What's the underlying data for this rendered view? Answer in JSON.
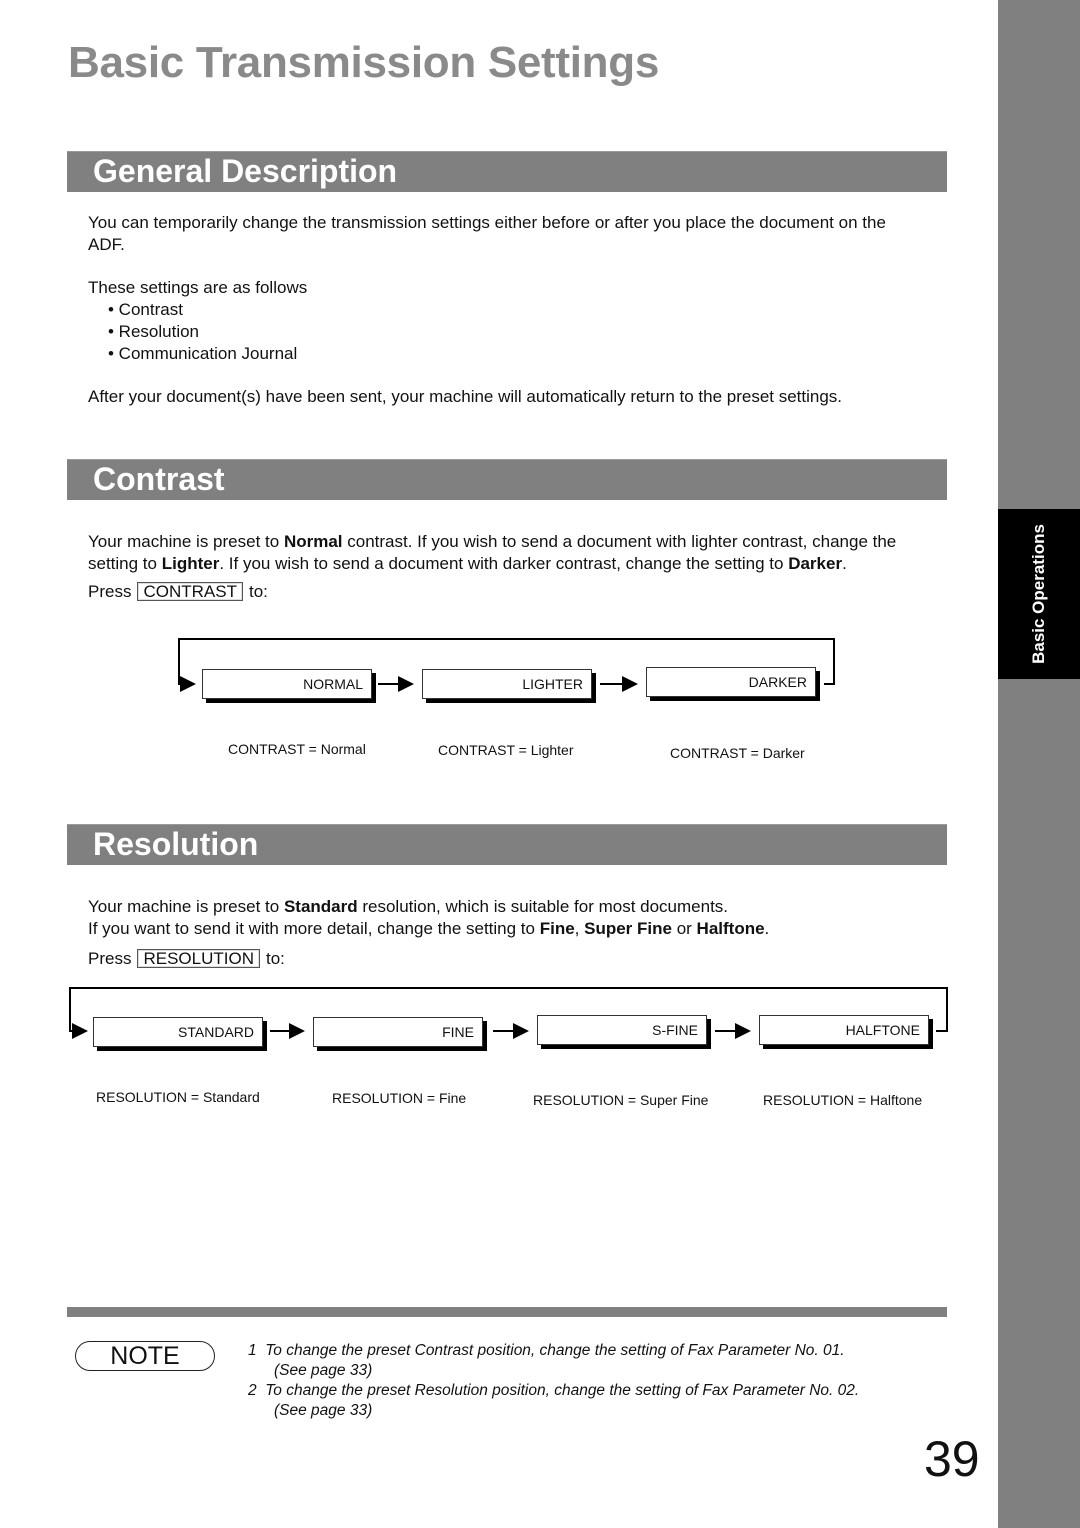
{
  "page_title": "Basic Transmission Settings",
  "side_tab": "Basic Operations",
  "sections": {
    "general": {
      "heading": "General Description",
      "intro_line1": "You can temporarily change the transmission settings either before or after you place the document on the",
      "intro_line2": "ADF.",
      "list_intro": "These settings are as follows",
      "items": [
        "• Contrast",
        "• Resolution",
        "• Communication Journal"
      ],
      "after": "After your document(s) have been sent, your machine will automatically return to the preset settings."
    },
    "contrast": {
      "heading": "Contrast",
      "line1_a": "Your machine is preset to ",
      "line1_b": "Normal",
      "line1_c": " contrast. If you wish to send a document with lighter contrast, change the",
      "line2_a": "setting to ",
      "line2_b": "Lighter",
      "line2_c": ". If you wish to send a document with darker contrast, change the setting to ",
      "line2_d": "Darker",
      "line2_e": ".",
      "press": "Press",
      "key": "CONTRAST",
      "to": "to:",
      "boxes": [
        "NORMAL",
        "LIGHTER",
        "DARKER"
      ],
      "captions": [
        "CONTRAST = Normal",
        "CONTRAST = Lighter",
        "CONTRAST = Darker"
      ]
    },
    "resolution": {
      "heading": "Resolution",
      "line1_a": "Your machine is preset to ",
      "line1_b": "Standard",
      "line1_c": " resolution, which is suitable for most documents.",
      "line2_a": "If you want to send it with more detail, change the setting to ",
      "line2_b": "Fine",
      "line2_c": ", ",
      "line2_d": "Super Fine",
      "line2_e": " or ",
      "line2_f": "Halftone",
      "line2_g": ".",
      "press": "Press",
      "key": "RESOLUTION",
      "to": "to:",
      "boxes": [
        "STANDARD",
        "FINE",
        "S-FINE",
        "HALFTONE"
      ],
      "captions": [
        "RESOLUTION = Standard",
        "RESOLUTION = Fine",
        "RESOLUTION = Super Fine",
        "RESOLUTION = Halftone"
      ]
    }
  },
  "note": {
    "label": "NOTE",
    "items": [
      {
        "num": "1",
        "text": "To change the preset Contrast position, change the setting of Fax Parameter No. 01.",
        "ref": "(See page 33)"
      },
      {
        "num": "2",
        "text": "To change the preset Resolution position, change the setting of Fax Parameter No. 02.",
        "ref": "(See page 33)"
      }
    ]
  },
  "page_number": "39"
}
